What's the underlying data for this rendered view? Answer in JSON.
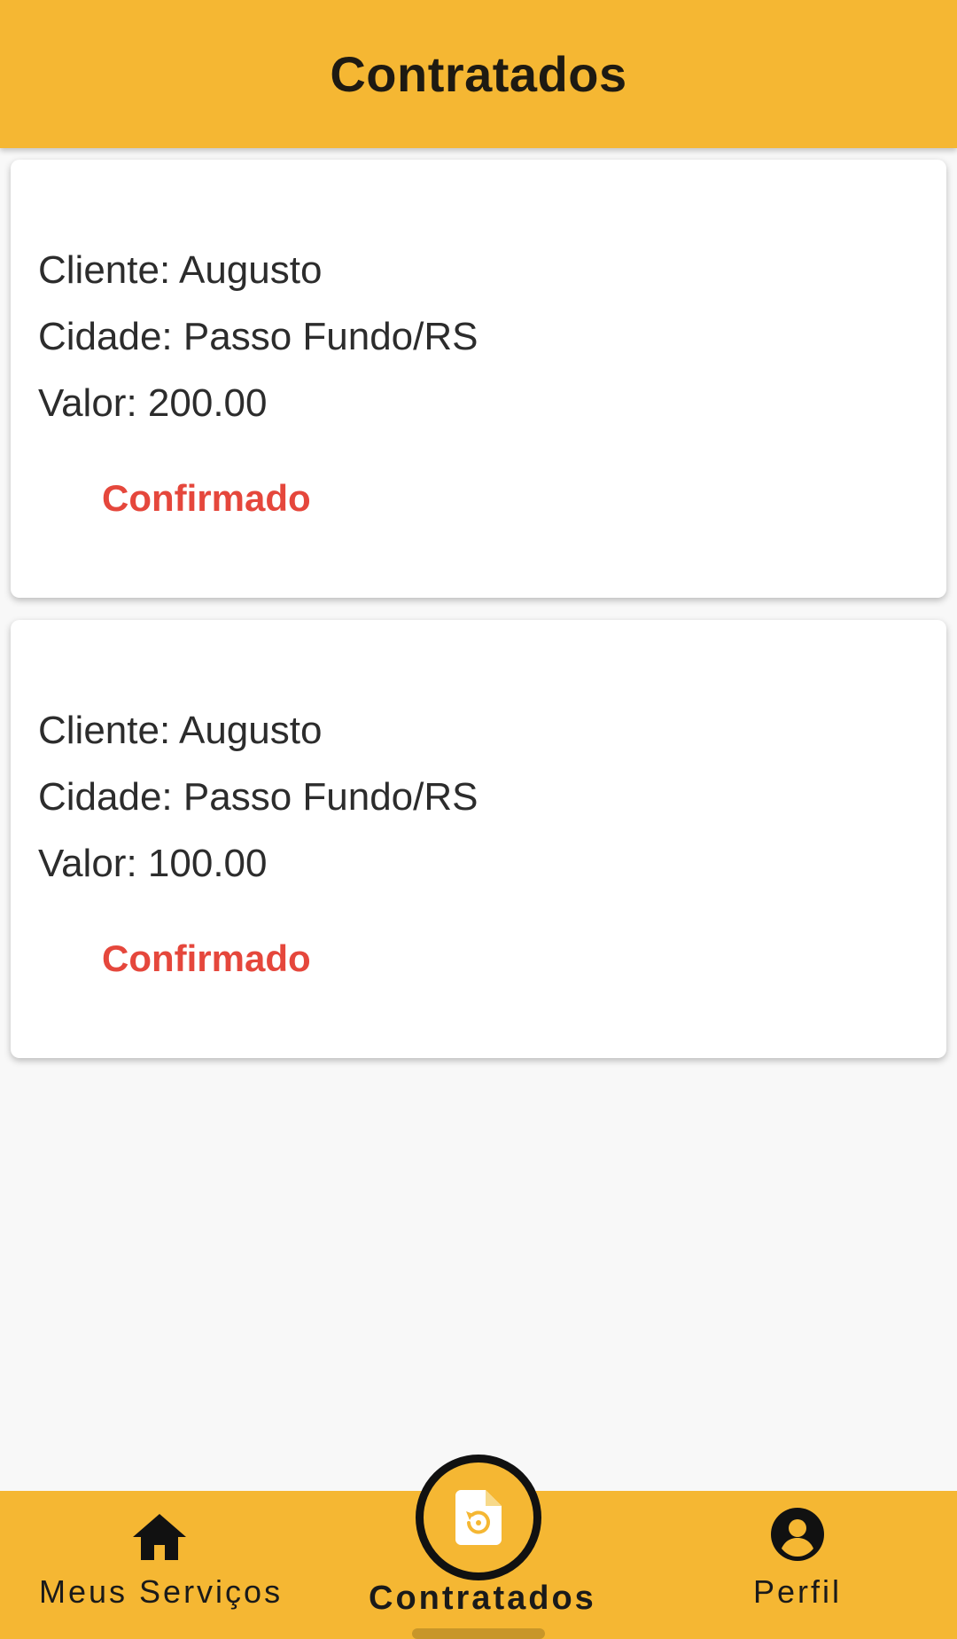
{
  "header": {
    "title": "Contratados"
  },
  "cards": [
    {
      "cliente": "Cliente: Augusto",
      "cidade": "Cidade: Passo Fundo/RS",
      "valor": "Valor: 200.00",
      "status": "Confirmado"
    },
    {
      "cliente": "Cliente: Augusto",
      "cidade": "Cidade: Passo Fundo/RS",
      "valor": "Valor: 100.00",
      "status": "Confirmado"
    }
  ],
  "bottom_nav": {
    "items": [
      {
        "label": "Meus Serviços",
        "icon": "home-icon"
      },
      {
        "label": "Contratados",
        "icon": "document-restore-icon",
        "active": true
      },
      {
        "label": "Perfil",
        "icon": "account-circle-icon"
      }
    ]
  },
  "colors": {
    "accent": "#f5b733",
    "status": "#e5473c",
    "text": "#2c2c2c"
  }
}
